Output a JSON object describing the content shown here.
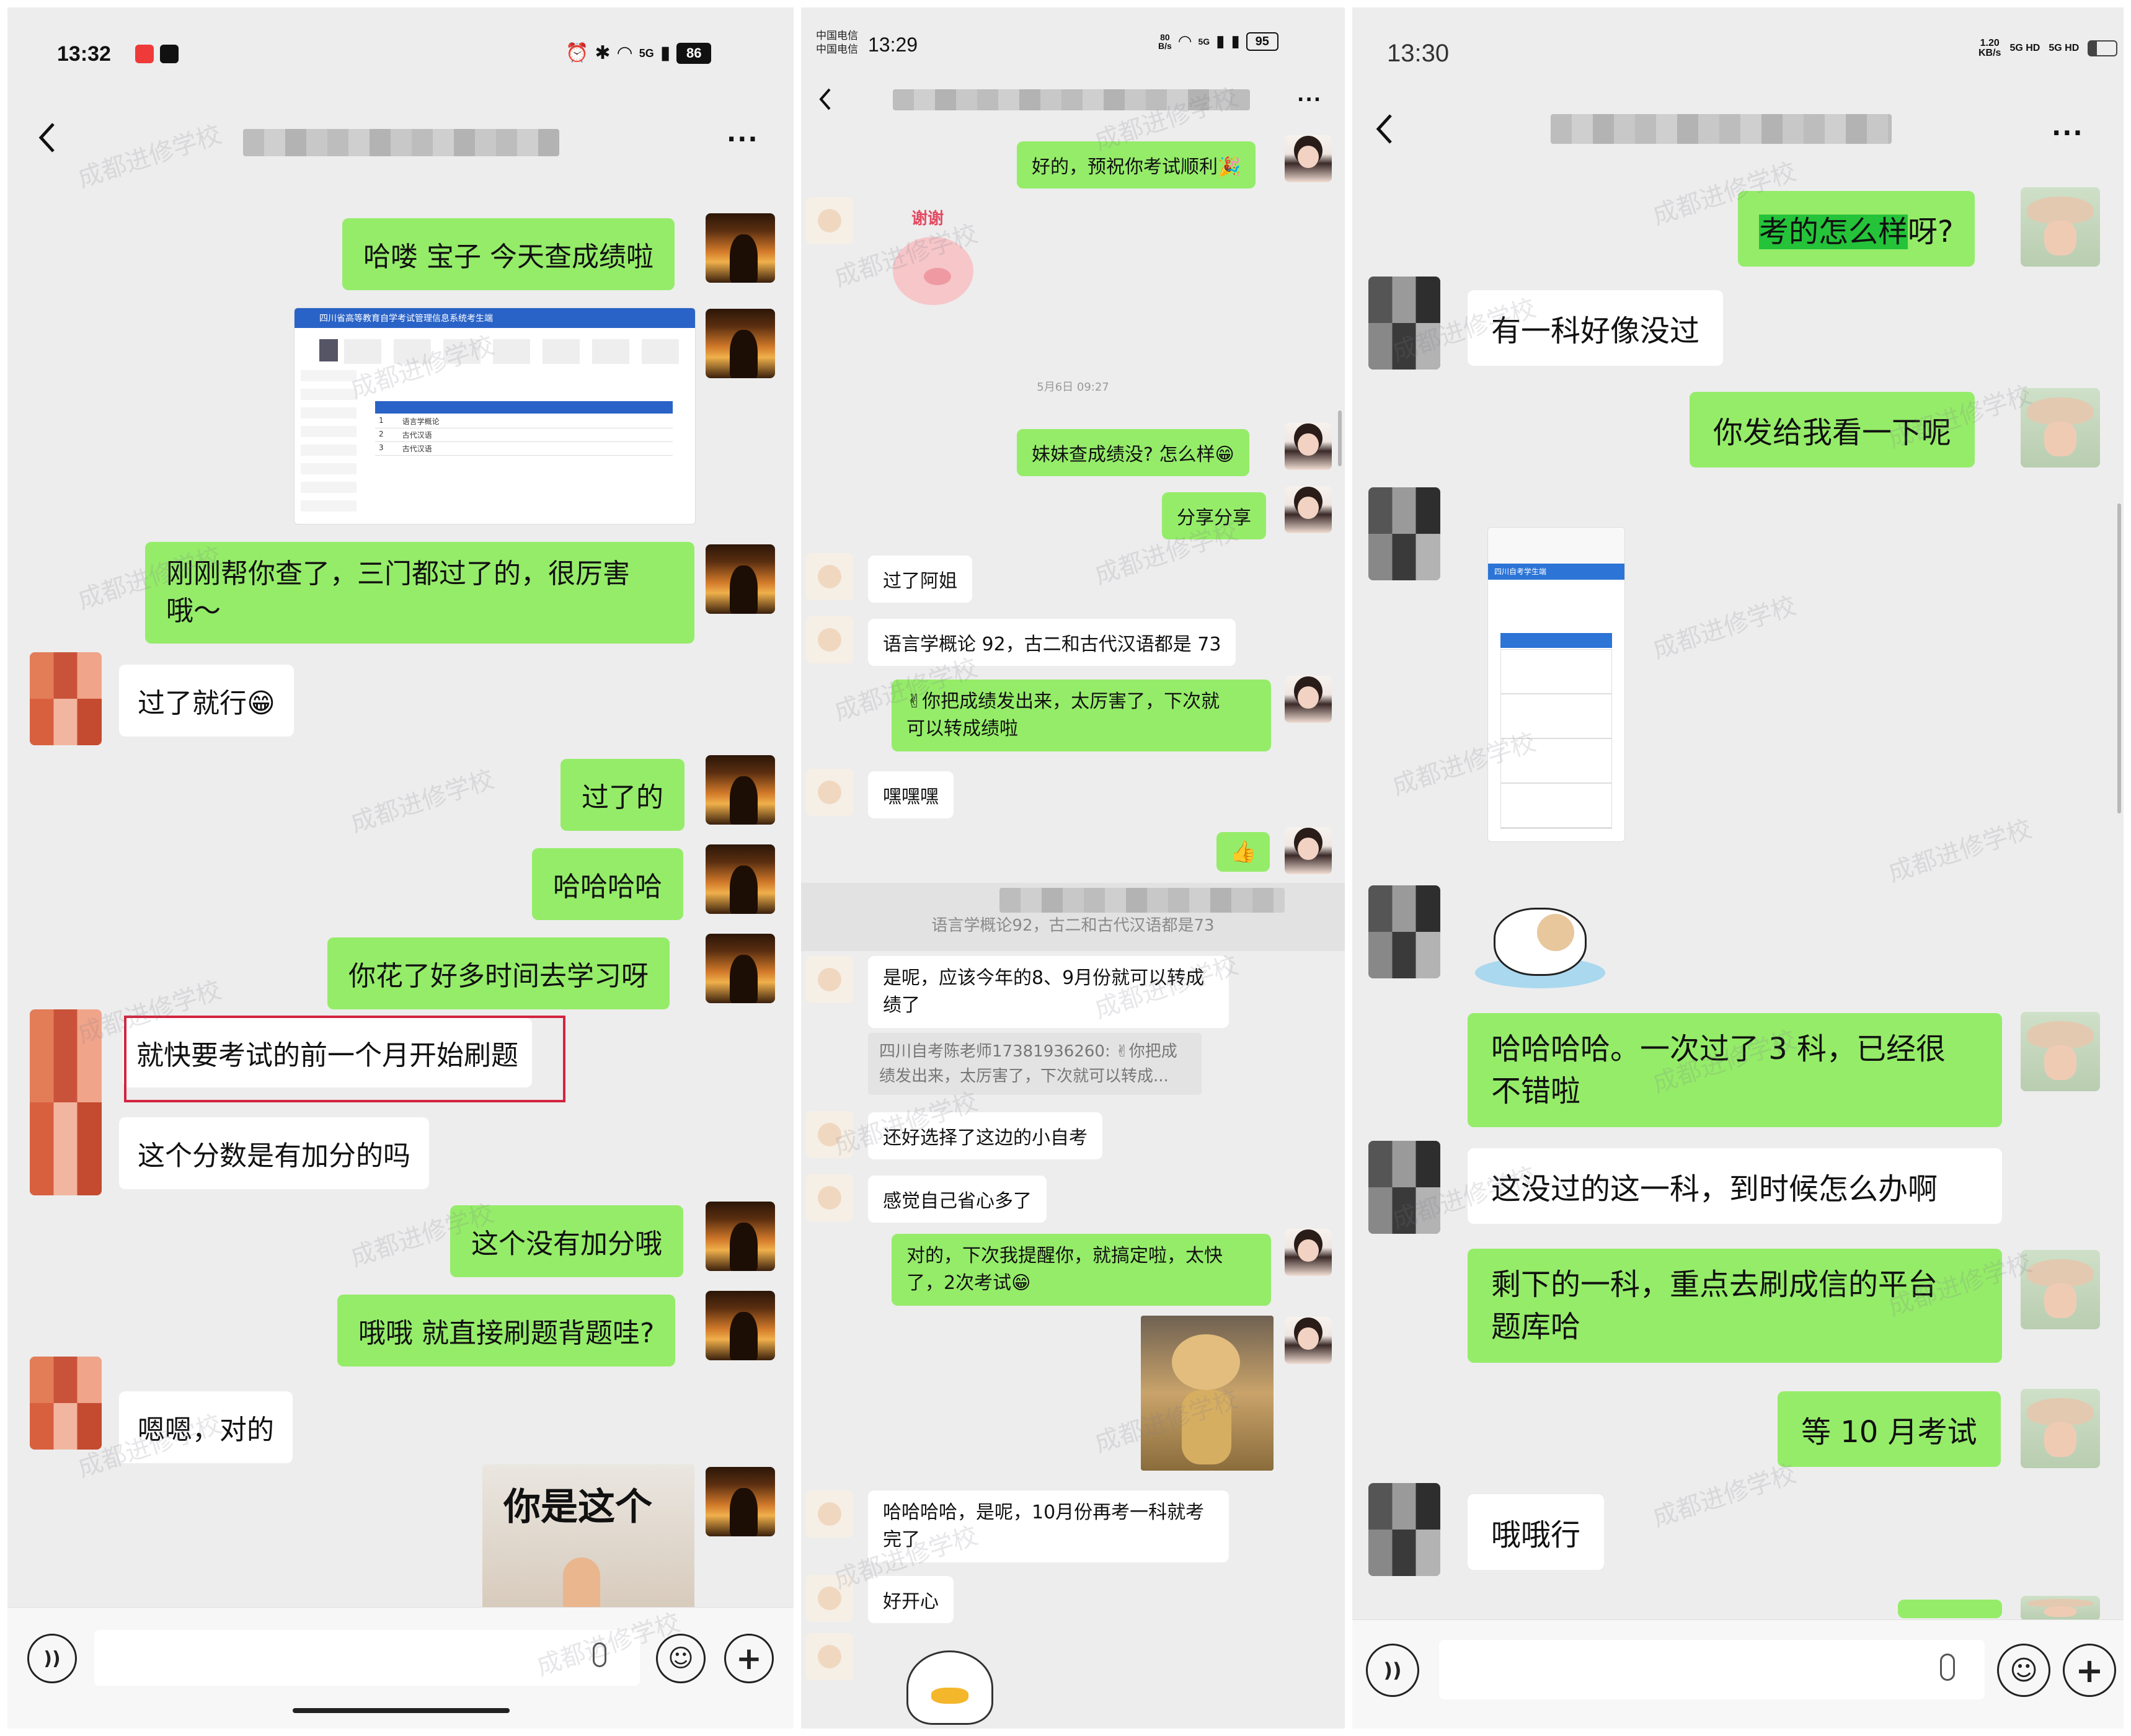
{
  "panel1": {
    "status": {
      "time": "13:32",
      "battery": "86",
      "net": "5G"
    },
    "more": "...",
    "messages": [
      {
        "side": "out",
        "text": "哈喽 宝子 今天查成绩啦"
      },
      {
        "side": "out",
        "text": "刚刚帮你查了，三门都过了的，很厉害\n哦～"
      },
      {
        "side": "in",
        "text": "过了就行😁"
      },
      {
        "side": "out",
        "text": "过了的"
      },
      {
        "side": "out",
        "text": "哈哈哈哈"
      },
      {
        "side": "out",
        "text": "你花了好多时间去学习呀"
      },
      {
        "side": "in",
        "text": "就快要考试的前一个月开始刷题"
      },
      {
        "side": "in",
        "text": "这个分数是有加分的吗"
      },
      {
        "side": "out",
        "text": "这个没有加分哦"
      },
      {
        "side": "out",
        "text": "哦哦 就直接刷题背题哇?"
      },
      {
        "side": "in",
        "text": "嗯嗯，对的"
      },
      {
        "side": "out",
        "text": "你是这个"
      }
    ],
    "screenshot": {
      "banner": "四川省高等教育自学考试管理信息系统考生端",
      "rows": [
        "1",
        "2",
        "3"
      ],
      "cells": [
        "语言学概论",
        "古代汉语",
        "古代汉语"
      ]
    }
  },
  "panel2": {
    "status": {
      "carrier1": "中国电信",
      "carrier2": "中国电信",
      "time": "13:29",
      "speed": "80\nB/s",
      "net": "5G",
      "battery": "95"
    },
    "more": "...",
    "messages": [
      {
        "side": "out",
        "text": "好的，预祝你考试顺利🎉"
      },
      {
        "side": "sticker",
        "text": "谢谢"
      },
      {
        "side": "out",
        "text": "妹妹查成绩没? 怎么样😁"
      },
      {
        "side": "out",
        "text": "分享分享"
      },
      {
        "side": "in",
        "text": "过了阿姐"
      },
      {
        "side": "in",
        "text": "语言学概论 92，古二和古代汉语都是 73"
      },
      {
        "side": "out",
        "text": "✌你把成绩发出来，太厉害了，下次就\n可以转成绩啦"
      },
      {
        "side": "in",
        "text": "嘿嘿嘿"
      },
      {
        "side": "out",
        "text": "👍"
      },
      {
        "side": "in",
        "text": "是呢，应该今年的8、9月份就可以转成\n绩了"
      },
      {
        "side": "in",
        "text": "还好选择了这边的小自考"
      },
      {
        "side": "in",
        "text": "感觉自己省心多了"
      },
      {
        "side": "out",
        "text": "对的，下次我提醒你，就搞定啦，太快\n了，2次考试😁"
      },
      {
        "side": "in",
        "text": "哈哈哈哈，是呢，10月份再考一科就考\n完了"
      },
      {
        "side": "in",
        "text": "好开心"
      }
    ],
    "timestamp": "5月6日 09:27",
    "recall": "语言学概论92，古二和古代汉语都是73",
    "quote": "四川自考陈老师17381936260: ✌你把成\n绩发出来，太厉害了，下次就可以转成..."
  },
  "panel3": {
    "status": {
      "time": "13:30",
      "speed": "1.20\nKB/s",
      "net1": "5G HD",
      "net2": "5G HD"
    },
    "more": "...",
    "messages": [
      {
        "side": "out",
        "text": "考的怎么样呀?",
        "highlight": "考的怎么样"
      },
      {
        "side": "in",
        "text": "有一科好像没过"
      },
      {
        "side": "out",
        "text": "你发给我看一下呢"
      },
      {
        "side": "out",
        "text": "哈哈哈哈。一次过了 3 科，已经很\n不错啦"
      },
      {
        "side": "in",
        "text": "这没过的这一科，到时候怎么办啊"
      },
      {
        "side": "out",
        "text": "剩下的一科，重点去刷成信的平台\n题库哈"
      },
      {
        "side": "out",
        "text": "等 10 月考试"
      },
      {
        "side": "in",
        "text": "哦哦行"
      }
    ],
    "phone_shot": {
      "title": "四川自考学生端"
    }
  },
  "watermark": "成都进修学校",
  "colors": {
    "outgoing": "#95ec69",
    "incoming": "#ffffff",
    "background": "#ededed",
    "highlight_box": "#d3243f"
  }
}
